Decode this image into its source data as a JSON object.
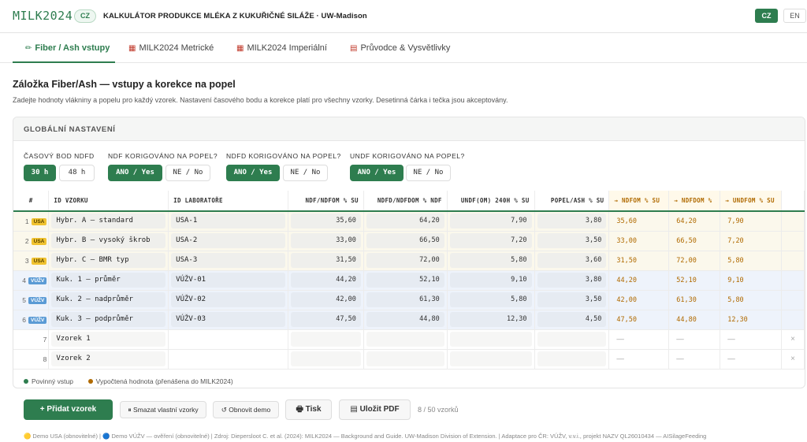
{
  "header": {
    "logo": "MILK2024",
    "lang_chip": "CZ",
    "title": "KALKULÁTOR PRODUKCE MLÉKA Z KUKUŘIČNÉ SILÁŽE · UW-Madison",
    "lang_cz": "CZ",
    "lang_en": "EN"
  },
  "tabs": [
    {
      "icon": "pencil-icon",
      "glyph": "✏",
      "label": "Fiber / Ash vstupy"
    },
    {
      "icon": "chart-icon",
      "glyph": "▦",
      "label": "MILK2024 Metrické"
    },
    {
      "icon": "chart-icon",
      "glyph": "▦",
      "label": "MILK2024 Imperiální"
    },
    {
      "icon": "book-icon",
      "glyph": "▤",
      "label": "Průvodce & Vysvětlivky"
    }
  ],
  "page": {
    "heading": "Záložka Fiber/Ash — vstupy a korekce na popel",
    "subtitle": "Zadejte hodnoty vlákniny a popelu pro každý vzorek. Nastavení časového bodu a korekce platí pro všechny vzorky. Desetinná čárka i tečka jsou akceptovány."
  },
  "global": {
    "title": "GLOBÁLNÍ NASTAVENÍ",
    "time_label": "ČASOVÝ BOD NDFD",
    "time_opts": [
      "30 h",
      "48 h"
    ],
    "ndf_label": "NDF KORIGOVÁNO NA POPEL?",
    "ndfd_label": "NDFD KORIGOVÁNO NA POPEL?",
    "undf_label": "UNDF KORIGOVÁNO NA POPEL?",
    "yes": "ANO / Yes",
    "no": "NE / No"
  },
  "table": {
    "columns": [
      "#",
      "ID VZORKU",
      "ID LABORATOŘE",
      "NDF/NDFOM % SU",
      "NDFD/NDFDOM % NDF",
      "UNDF(OM) 240H % SU",
      "POPEL/ASH % SU",
      "→ NDFOM % SU",
      "→ NDFDOM %",
      "→ UNDFOM % SU"
    ],
    "rows": [
      {
        "n": "1",
        "tag": "USA",
        "id": "Hybr. A — standard",
        "lab": "USA-1",
        "ndf": "35,60",
        "ndfd": "64,20",
        "undf": "7,90",
        "ash": "3,80",
        "c1": "35,60",
        "c2": "64,20",
        "c3": "7,90"
      },
      {
        "n": "2",
        "tag": "USA",
        "id": "Hybr. B — vysoký škrob",
        "lab": "USA-2",
        "ndf": "33,00",
        "ndfd": "66,50",
        "undf": "7,20",
        "ash": "3,50",
        "c1": "33,00",
        "c2": "66,50",
        "c3": "7,20"
      },
      {
        "n": "3",
        "tag": "USA",
        "id": "Hybr. C — BMR typ",
        "lab": "USA-3",
        "ndf": "31,50",
        "ndfd": "72,00",
        "undf": "5,80",
        "ash": "3,60",
        "c1": "31,50",
        "c2": "72,00",
        "c3": "5,80"
      },
      {
        "n": "4",
        "tag": "VÚŽV",
        "id": "Kuk. 1 — průměr",
        "lab": "VÚŽV-01",
        "ndf": "44,20",
        "ndfd": "52,10",
        "undf": "9,10",
        "ash": "3,80",
        "c1": "44,20",
        "c2": "52,10",
        "c3": "9,10"
      },
      {
        "n": "5",
        "tag": "VÚŽV",
        "id": "Kuk. 2 — nadprůměr",
        "lab": "VÚŽV-02",
        "ndf": "42,00",
        "ndfd": "61,30",
        "undf": "5,80",
        "ash": "3,50",
        "c1": "42,00",
        "c2": "61,30",
        "c3": "5,80"
      },
      {
        "n": "6",
        "tag": "VÚŽV",
        "id": "Kuk. 3 — podprůměr",
        "lab": "VÚŽV-03",
        "ndf": "47,50",
        "ndfd": "44,80",
        "undf": "12,30",
        "ash": "4,50",
        "c1": "47,50",
        "c2": "44,80",
        "c3": "12,30"
      },
      {
        "n": "7",
        "tag": "",
        "id": "Vzorek 1",
        "lab": "",
        "ndf": "",
        "ndfd": "",
        "undf": "",
        "ash": "",
        "c1": "—",
        "c2": "—",
        "c3": "—"
      },
      {
        "n": "8",
        "tag": "",
        "id": "Vzorek 2",
        "lab": "",
        "ndf": "",
        "ndfd": "",
        "undf": "",
        "ash": "",
        "c1": "—",
        "c2": "—",
        "c3": "—"
      }
    ],
    "delete_glyph": "×"
  },
  "legend": {
    "required": "Povinný vstup",
    "computed": "Vypočtená hodnota (přenášena do MILK2024)",
    "required_color": "#2e7d4f",
    "computed_color": "#b06a00"
  },
  "actions": {
    "add": "+ Přidat vzorek",
    "clear": "⏸ Smazat vlastní vzorky",
    "restore": "↺ Obnovit demo",
    "print": "🖶 Tisk",
    "pdf": "▤ Uložit PDF",
    "count": "8 / 50 vzorků"
  },
  "footer": "🟡 Demo USA (obnovitelné) | 🔵 Demo VÚŽV — ověření (obnovitelné) | Zdroj: Diepersloot C. et al. (2024): MILK2024 — Background and Guide. UW-Madison Division of Extension. | Adaptace pro ČR: VÚŽV, v.v.i., projekt NAZV QL26010434 — AISilageFeeding"
}
